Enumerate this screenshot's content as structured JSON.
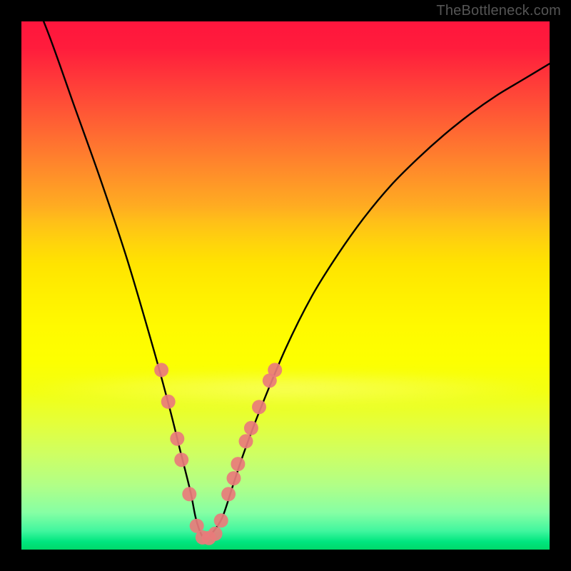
{
  "watermark": "TheBottleneck.com",
  "chart_data": {
    "type": "line",
    "title": "",
    "xlabel": "",
    "ylabel": "",
    "xlim": [
      0,
      100
    ],
    "ylim": [
      0,
      100
    ],
    "series": [
      {
        "name": "bottleneck-curve",
        "x": [
          0,
          5,
          10,
          15,
          20,
          25,
          28,
          30,
          32,
          33,
          34,
          35,
          36,
          38,
          40,
          42,
          45,
          50,
          55,
          60,
          65,
          70,
          75,
          80,
          85,
          90,
          95,
          100
        ],
        "values": [
          110,
          98,
          84,
          70,
          55,
          38,
          27,
          19,
          11,
          6,
          3,
          2,
          3,
          6,
          12,
          18,
          26,
          38,
          48,
          56,
          63,
          69,
          74,
          78.5,
          82.5,
          86,
          89,
          92
        ]
      }
    ],
    "markers": {
      "name": "highlighted-points",
      "color": "#e97b7b",
      "radius": 10,
      "points": [
        {
          "x": 26.5,
          "y": 34
        },
        {
          "x": 27.8,
          "y": 28
        },
        {
          "x": 29.5,
          "y": 21
        },
        {
          "x": 30.3,
          "y": 17
        },
        {
          "x": 31.8,
          "y": 10.5
        },
        {
          "x": 33.2,
          "y": 4.5
        },
        {
          "x": 34.3,
          "y": 2.3
        },
        {
          "x": 35.5,
          "y": 2.2
        },
        {
          "x": 36.7,
          "y": 3.0
        },
        {
          "x": 37.8,
          "y": 5.5
        },
        {
          "x": 39.2,
          "y": 10.5
        },
        {
          "x": 40.2,
          "y": 13.5
        },
        {
          "x": 41.0,
          "y": 16.2
        },
        {
          "x": 42.5,
          "y": 20.5
        },
        {
          "x": 43.5,
          "y": 23.0
        },
        {
          "x": 45.0,
          "y": 27.0
        },
        {
          "x": 47.0,
          "y": 32.0
        },
        {
          "x": 48.0,
          "y": 34.0
        }
      ]
    },
    "gradient_stops": [
      {
        "pos": 0.0,
        "color": "#ff163d"
      },
      {
        "pos": 0.5,
        "color": "#fff000"
      },
      {
        "pos": 0.97,
        "color": "#40f69e"
      },
      {
        "pos": 1.0,
        "color": "#00d96a"
      }
    ]
  }
}
